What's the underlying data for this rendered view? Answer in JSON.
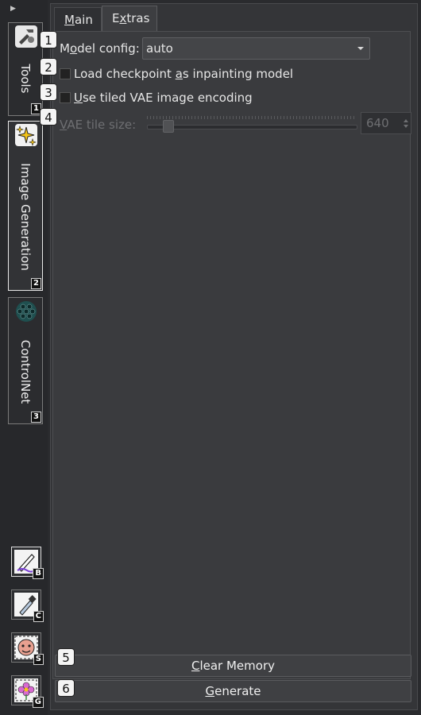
{
  "sidebar": {
    "tabs": [
      {
        "label": "Tools",
        "badge": "1",
        "icon": "tools-icon"
      },
      {
        "label": "Image Generation",
        "badge": "2",
        "icon": "sparkles-icon"
      },
      {
        "label": "ControlNet",
        "badge": "3",
        "icon": "hexagon-grid-icon"
      }
    ],
    "tools": [
      {
        "name": "brush",
        "badge": "B",
        "icon": "brush-icon"
      },
      {
        "name": "color-picker",
        "badge": "C",
        "icon": "eyedropper-icon"
      },
      {
        "name": "selection",
        "badge": "S",
        "icon": "face-icon"
      },
      {
        "name": "generate",
        "badge": "G",
        "icon": "flower-icon"
      }
    ]
  },
  "panel": {
    "tabs": [
      {
        "label_pre": "",
        "label_u": "M",
        "label_post": "ain"
      },
      {
        "label_pre": "E",
        "label_u": "x",
        "label_post": "tras"
      }
    ],
    "model_config": {
      "label_pre": "M",
      "label_u": "o",
      "label_post": "del config:",
      "value": "auto"
    },
    "load_checkpoint": {
      "label_pre": "Load checkpoint ",
      "label_u": "a",
      "label_post": "s inpainting model"
    },
    "tiled_vae": {
      "label_pre": "",
      "label_u": "U",
      "label_post": "se tiled VAE image encoding"
    },
    "vae_tile_size": {
      "label_pre": "",
      "label_u": "V",
      "label_post": "AE tile size:",
      "value": "640"
    },
    "clear_memory": {
      "label_pre": "",
      "label_u": "C",
      "label_post": "lear Memory"
    },
    "generate": {
      "label_pre": "",
      "label_u": "G",
      "label_post": "enerate"
    }
  },
  "markers": [
    "1",
    "2",
    "3",
    "4",
    "5",
    "6"
  ]
}
